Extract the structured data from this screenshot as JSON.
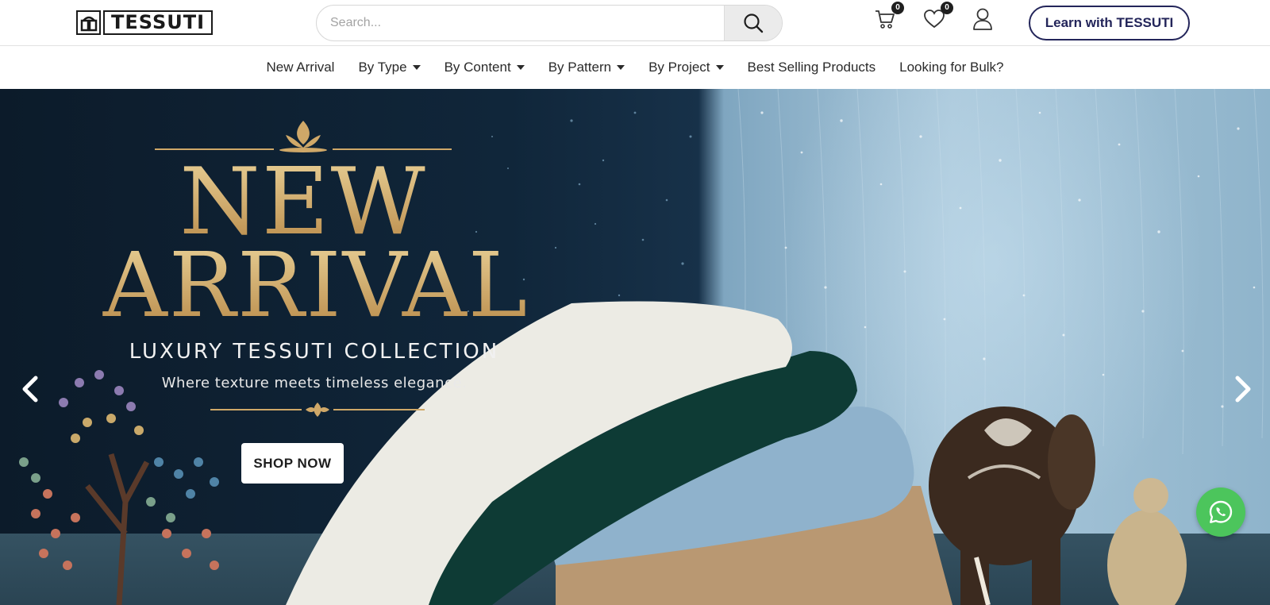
{
  "header": {
    "logo_text": "TESSUTI",
    "search": {
      "placeholder": "Search..."
    },
    "cart_count": "0",
    "wishlist_count": "0",
    "learn_button": "Learn with TESSUTI"
  },
  "nav": {
    "items": [
      {
        "label": "New Arrival",
        "dropdown": false
      },
      {
        "label": "By Type",
        "dropdown": true
      },
      {
        "label": "By Content",
        "dropdown": true
      },
      {
        "label": "By Pattern",
        "dropdown": true
      },
      {
        "label": "By Project",
        "dropdown": true
      },
      {
        "label": "Best Selling Products",
        "dropdown": false
      },
      {
        "label": "Looking for Bulk?",
        "dropdown": false
      }
    ]
  },
  "hero": {
    "title_line1": "NEW",
    "title_line2": "ARRIVAL",
    "subtitle": "LUXURY TESSUTI COLLECTION",
    "tagline": "Where texture meets timeless elegance.",
    "cta": "SHOP NOW"
  },
  "icons": {
    "search": "search-icon",
    "cart": "cart-icon",
    "wishlist": "heart-icon",
    "account": "user-icon",
    "prev": "chevron-left-icon",
    "next": "chevron-right-icon",
    "whatsapp": "whatsapp-icon"
  },
  "colors": {
    "brand_navy": "#23255a",
    "gold": "#cfa868",
    "whatsapp_green": "#4cc55c"
  }
}
